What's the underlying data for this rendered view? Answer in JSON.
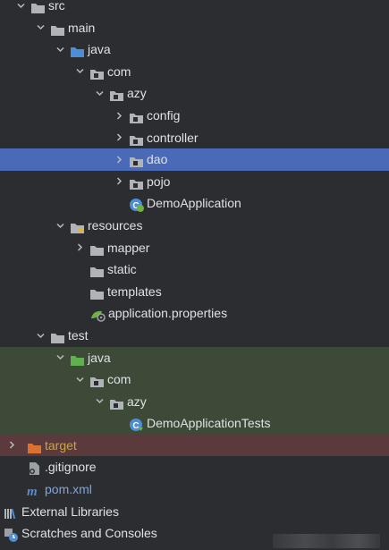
{
  "tree": [
    {
      "label": "src",
      "indent": 0,
      "chevron": "down",
      "icon": "folder-gray",
      "style": ""
    },
    {
      "label": "main",
      "indent": 1,
      "chevron": "down",
      "icon": "folder-gray",
      "style": ""
    },
    {
      "label": "java",
      "indent": 2,
      "chevron": "down",
      "icon": "folder-blue",
      "style": ""
    },
    {
      "label": "com",
      "indent": 3,
      "chevron": "down",
      "icon": "package",
      "style": ""
    },
    {
      "label": "azy",
      "indent": 4,
      "chevron": "down",
      "icon": "package",
      "style": ""
    },
    {
      "label": "config",
      "indent": 5,
      "chevron": "right",
      "icon": "package",
      "style": ""
    },
    {
      "label": "controller",
      "indent": 5,
      "chevron": "right",
      "icon": "package",
      "style": ""
    },
    {
      "label": "dao",
      "indent": 5,
      "chevron": "right",
      "icon": "package",
      "style": "selected"
    },
    {
      "label": "pojo",
      "indent": 5,
      "chevron": "right",
      "icon": "package",
      "style": ""
    },
    {
      "label": "DemoApplication",
      "indent": 5,
      "chevron": "none",
      "icon": "spring-class",
      "style": ""
    },
    {
      "label": "resources",
      "indent": 2,
      "chevron": "down",
      "icon": "folder-resources",
      "style": ""
    },
    {
      "label": "mapper",
      "indent": 3,
      "chevron": "right",
      "icon": "folder-gray",
      "style": ""
    },
    {
      "label": "static",
      "indent": 3,
      "chevron": "none",
      "icon": "folder-gray",
      "style": ""
    },
    {
      "label": "templates",
      "indent": 3,
      "chevron": "none",
      "icon": "folder-gray",
      "style": ""
    },
    {
      "label": "application.properties",
      "indent": 3,
      "chevron": "none",
      "icon": "spring-properties",
      "style": ""
    },
    {
      "label": "test",
      "indent": 1,
      "chevron": "down",
      "icon": "folder-gray",
      "style": ""
    },
    {
      "label": "java",
      "indent": 2,
      "chevron": "down",
      "icon": "folder-green",
      "style": "test-bg"
    },
    {
      "label": "com",
      "indent": 3,
      "chevron": "down",
      "icon": "package",
      "style": "test-bg"
    },
    {
      "label": "azy",
      "indent": 4,
      "chevron": "down",
      "icon": "package",
      "style": "test-bg"
    },
    {
      "label": "DemoApplicationTests",
      "indent": 5,
      "chevron": "none",
      "icon": "test-class",
      "style": "test-bg"
    },
    {
      "label": "target",
      "indent": 0,
      "chevron": "right",
      "icon": "folder-orange",
      "style": "excluded"
    },
    {
      "label": ".gitignore",
      "indent": 0,
      "chevron": "none",
      "icon": "gitignore-file",
      "style": ""
    },
    {
      "label": "pom.xml",
      "indent": 0,
      "chevron": "none",
      "icon": "maven-file",
      "style": "pom"
    },
    {
      "label": "External Libraries",
      "indent": -1,
      "chevron": "none",
      "icon": "libraries",
      "style": ""
    },
    {
      "label": "Scratches and Consoles",
      "indent": -1,
      "chevron": "none",
      "icon": "scratches",
      "style": ""
    }
  ],
  "colors": {
    "background": "#2b2d30",
    "selected": "#4a6ab8",
    "test_row": "#3d4a38",
    "excluded_row": "#5a3a3c",
    "folder_gray": "#b0b3b8",
    "folder_blue": "#4e8ed6",
    "folder_green": "#5fb04e",
    "folder_orange": "#d9722e",
    "target_text": "#c9a44a",
    "pom_text": "#7ba7e3"
  }
}
